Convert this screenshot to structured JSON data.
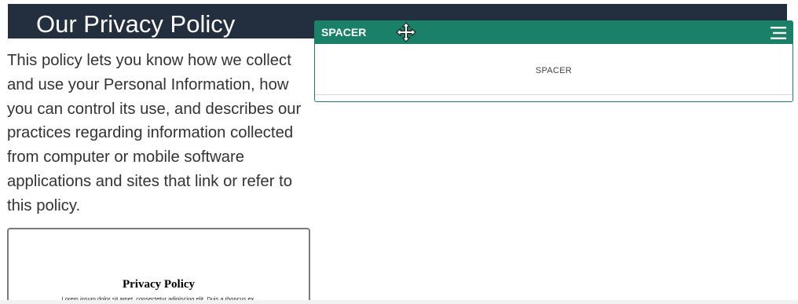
{
  "header": {
    "title": "Our Privacy Policy",
    "background": "#232f3e"
  },
  "intro": {
    "text": "This policy lets you know how we collect and use your Personal Information, how you can control its use, and describes our practices regarding information collected from computer or mobile software applications and sites that link or refer to this policy."
  },
  "document_preview": {
    "title": "Privacy Policy",
    "body": "Lorem ipsum dolor sit amet, consectetur adipiscing elit. Duis a rhoncus ex."
  },
  "widget": {
    "title": "SPACER",
    "body_label": "SPACER",
    "accent": "#1a8068",
    "icons": [
      "move-icon",
      "menu-icon"
    ]
  }
}
